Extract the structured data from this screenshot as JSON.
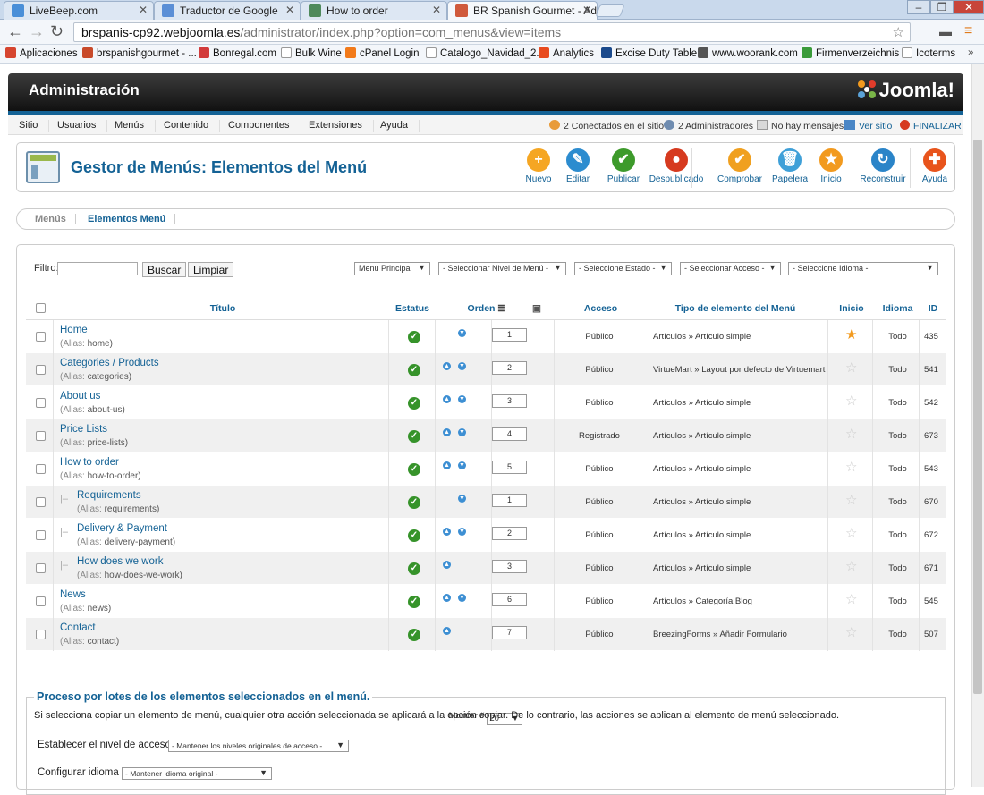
{
  "browser": {
    "tabs": [
      {
        "title": "LiveBeep.com",
        "color": "#4a8fd8"
      },
      {
        "title": "Traductor de Google",
        "color": "#5b8fd6"
      },
      {
        "title": "How to order",
        "color": "#4f8a5c"
      },
      {
        "title": "BR Spanish Gourmet - Ad",
        "color": "#d05a3c"
      }
    ],
    "url_host": "brspanis-cp92.webjoomla.es",
    "url_path": "/administrator/index.php?option=com_menus&view=items",
    "bookmarks": [
      {
        "label": "Aplicaciones",
        "color": "#d6452f"
      },
      {
        "label": "brspanishgourmet - ...",
        "color": "#c84a2a"
      },
      {
        "label": "Bonregal.com",
        "color": "#d23b3b"
      },
      {
        "label": "Bulk Wine",
        "color": "#ffffff"
      },
      {
        "label": "cPanel Login",
        "color": "#f27a1a"
      },
      {
        "label": "Catalogo_Navidad_2...",
        "color": "#ffffff"
      },
      {
        "label": "Analytics",
        "color": "#e84b1f"
      },
      {
        "label": "Excise Duty Table",
        "color": "#1b4a8c"
      },
      {
        "label": "www.woorank.com",
        "color": "#555555"
      },
      {
        "label": "Firmenverzeichnis",
        "color": "#3a9b3a"
      },
      {
        "label": "Icoterms",
        "color": "#ffffff"
      }
    ]
  },
  "header": {
    "title": "Administración",
    "brand": "Joomla!"
  },
  "menu": {
    "items": [
      "Sitio",
      "Usuarios",
      "Menús",
      "Contenido",
      "Componentes",
      "Extensiones",
      "Ayuda"
    ],
    "status": {
      "online": "2 Conectados en el sitio",
      "admins": "2 Administradores",
      "messages": "No hay mensajes",
      "view_site": "Ver sitio",
      "logout": "FINALIZAR"
    }
  },
  "toolbar": {
    "page_title": "Gestor de Menús: Elementos del Menú",
    "buttons": [
      {
        "label": "Nuevo",
        "color": "#f5a623",
        "glyph": "+"
      },
      {
        "label": "Editar",
        "color": "#2c8ccf",
        "glyph": "✎"
      },
      {
        "label": "Publicar",
        "color": "#3d9a2b",
        "glyph": "✔"
      },
      {
        "label": "Despublicado",
        "color": "#d63a1f",
        "glyph": "●"
      },
      {
        "label": "Comprobar",
        "color": "#f0a020",
        "glyph": "✔"
      },
      {
        "label": "Papelera",
        "color": "#3fa0d8",
        "glyph": "🗑"
      },
      {
        "label": "Inicio",
        "color": "#f29a1e",
        "glyph": "★"
      },
      {
        "label": "Reconstruir",
        "color": "#2a84c8",
        "glyph": "↻"
      },
      {
        "label": "Ayuda",
        "color": "#e8541c",
        "glyph": "✚"
      }
    ]
  },
  "subnav": {
    "menus": "Menús",
    "items": "Elementos Menú"
  },
  "filters": {
    "label": "Filtro:",
    "search_btn": "Buscar",
    "clear_btn": "Limpiar",
    "menu": "Menu Principal",
    "level": "- Seleccionar Nivel de Menú -",
    "state": "- Seleccione Estado -",
    "access": "- Seleccionar Acceso -",
    "language": "- Seleccione Idioma -"
  },
  "table": {
    "headers": {
      "title": "Título",
      "status": "Estatus",
      "order": "Orden",
      "access": "Acceso",
      "type": "Tipo de elemento del Menú",
      "home": "Inicio",
      "language": "Idioma",
      "id": "ID"
    },
    "alias_label": "(Alias:",
    "rows": [
      {
        "title": "Home",
        "alias": "home)",
        "level": 1,
        "up": false,
        "down": true,
        "order": "1",
        "access": "Público",
        "type": "Artículos » Artículo simple",
        "home": true,
        "lang": "Todo",
        "id": "435"
      },
      {
        "title": "Categories / Products",
        "alias": "categories)",
        "level": 1,
        "up": true,
        "down": true,
        "order": "2",
        "access": "Público",
        "type": "VirtueMart » Layout por defecto de Virtuemart",
        "home": false,
        "lang": "Todo",
        "id": "541"
      },
      {
        "title": "About us",
        "alias": "about-us)",
        "level": 1,
        "up": true,
        "down": true,
        "order": "3",
        "access": "Público",
        "type": "Artículos » Artículo simple",
        "home": false,
        "lang": "Todo",
        "id": "542"
      },
      {
        "title": "Price Lists",
        "alias": "price-lists)",
        "level": 1,
        "up": true,
        "down": true,
        "order": "4",
        "access": "Registrado",
        "type": "Artículos » Artículo simple",
        "home": false,
        "lang": "Todo",
        "id": "673"
      },
      {
        "title": "How to order",
        "alias": "how-to-order)",
        "level": 1,
        "up": true,
        "down": true,
        "order": "5",
        "access": "Público",
        "type": "Artículos » Artículo simple",
        "home": false,
        "lang": "Todo",
        "id": "543"
      },
      {
        "title": "Requirements",
        "alias": "requirements)",
        "level": 2,
        "up": false,
        "down": true,
        "order": "1",
        "access": "Público",
        "type": "Artículos » Artículo simple",
        "home": false,
        "lang": "Todo",
        "id": "670"
      },
      {
        "title": "Delivery & Payment",
        "alias": "delivery-payment)",
        "level": 2,
        "up": true,
        "down": true,
        "order": "2",
        "access": "Público",
        "type": "Artículos » Artículo simple",
        "home": false,
        "lang": "Todo",
        "id": "672"
      },
      {
        "title": "How does we work",
        "alias": "how-does-we-work)",
        "level": 2,
        "up": true,
        "down": false,
        "order": "3",
        "access": "Público",
        "type": "Artículos » Artículo simple",
        "home": false,
        "lang": "Todo",
        "id": "671"
      },
      {
        "title": "News",
        "alias": "news)",
        "level": 1,
        "up": true,
        "down": true,
        "order": "6",
        "access": "Público",
        "type": "Artículos » Categoría Blog",
        "home": false,
        "lang": "Todo",
        "id": "545"
      },
      {
        "title": "Contact",
        "alias": "contact)",
        "level": 1,
        "up": true,
        "down": false,
        "order": "7",
        "access": "Público",
        "type": "BreezingForms » Añadir Formulario",
        "home": false,
        "lang": "Todo",
        "id": "507"
      }
    ]
  },
  "pagination": {
    "label": "Mostrar #",
    "value": "20"
  },
  "batch": {
    "legend": "Proceso por lotes de los elementos seleccionados en el menú.",
    "description": "Si selecciona copiar un elemento de menú, cualquier otra acción seleccionada se aplicará a la opción copiar. De lo contrario, las acciones se aplican al elemento de menú seleccionado.",
    "access_label": "Establecer el nivel de acceso",
    "access_value": "- Mantener los niveles originales de acceso -",
    "lang_label": "Configurar idioma",
    "lang_value": "- Mantener idioma original -"
  },
  "colors": {
    "primary": "#146295",
    "published": "#36932a",
    "home_star": "#f29a1e"
  }
}
